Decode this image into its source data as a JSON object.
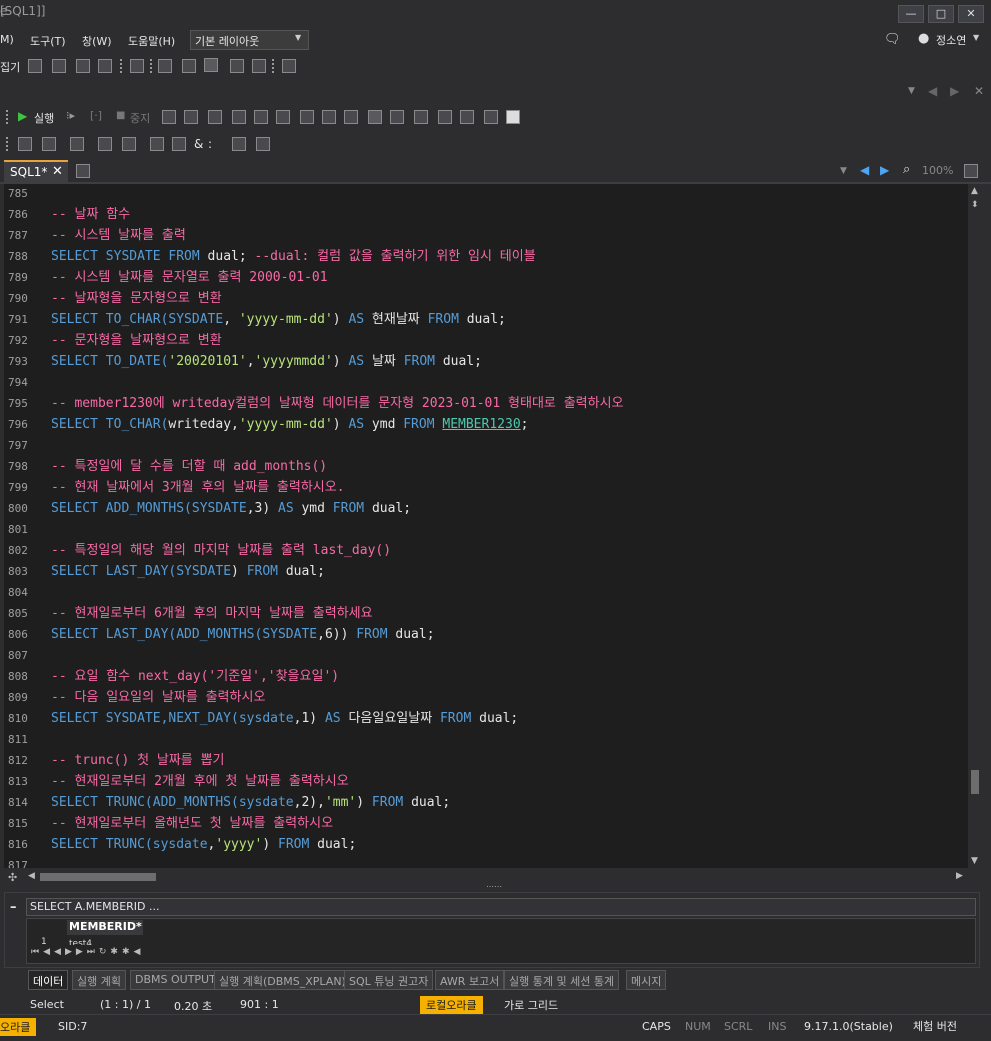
{
  "window": {
    "title": "[SQL1]]",
    "min": "—",
    "max": "□",
    "close": "✕"
  },
  "menu": {
    "items": [
      "M)",
      "도구(T)",
      "창(W)",
      "도움말(H)"
    ],
    "layout_select": "기본 레이아웃",
    "user": "정소연"
  },
  "toolbar": {
    "left_label": "집기",
    "run": "실행",
    "stop": "중지",
    "zoom": "100%"
  },
  "tabs": {
    "active": "SQL1*",
    "close": "✕"
  },
  "editor": {
    "lines": [
      {
        "n": "785",
        "t": []
      },
      {
        "n": "786",
        "t": [
          [
            "c",
            "-- 날짜 함수"
          ]
        ]
      },
      {
        "n": "787",
        "t": [
          [
            "c",
            "-- 시스템 날짜를 출력"
          ]
        ]
      },
      {
        "n": "788",
        "t": [
          [
            "k",
            "SELECT SYSDATE FROM "
          ],
          [
            "p",
            "dual; "
          ],
          [
            "c",
            "--dual: 컬럼 값을 출력하기 위한 임시 테이블"
          ]
        ]
      },
      {
        "n": "789",
        "t": [
          [
            "c",
            "-- 시스템 날짜를 문자열로 출력 2000-01-01"
          ]
        ]
      },
      {
        "n": "790",
        "t": [
          [
            "c",
            "-- 날짜형을 문자형으로 변환"
          ]
        ]
      },
      {
        "n": "791",
        "t": [
          [
            "k",
            "SELECT TO_CHAR("
          ],
          [
            "k",
            "SYSDATE"
          ],
          [
            "p",
            ", "
          ],
          [
            "s",
            "'yyyy-mm-dd'"
          ],
          [
            "p",
            ") "
          ],
          [
            "k",
            "AS "
          ],
          [
            "p",
            "현재날짜 "
          ],
          [
            "k",
            "FROM "
          ],
          [
            "p",
            "dual;"
          ]
        ]
      },
      {
        "n": "792",
        "t": [
          [
            "c",
            "-- 문자형을 날짜형으로 변환"
          ]
        ]
      },
      {
        "n": "793",
        "t": [
          [
            "k",
            "SELECT TO_DATE("
          ],
          [
            "s",
            "'20020101'"
          ],
          [
            "p",
            ","
          ],
          [
            "s",
            "'yyyymmdd'"
          ],
          [
            "p",
            ") "
          ],
          [
            "k",
            "AS "
          ],
          [
            "p",
            "날짜 "
          ],
          [
            "k",
            "FROM "
          ],
          [
            "p",
            "dual;"
          ]
        ]
      },
      {
        "n": "794",
        "t": []
      },
      {
        "n": "795",
        "t": [
          [
            "c",
            "-- member1230에 writeday컬럼의 날짜형 데이터를 문자형 2023-01-01 형태대로 출력하시오"
          ]
        ]
      },
      {
        "n": "796",
        "t": [
          [
            "k",
            "SELECT TO_CHAR("
          ],
          [
            "p",
            "writeday,"
          ],
          [
            "s",
            "'yyyy-mm-dd'"
          ],
          [
            "p",
            ") "
          ],
          [
            "k",
            "AS "
          ],
          [
            "p",
            "ymd "
          ],
          [
            "k",
            "FROM "
          ],
          [
            "u",
            "MEMBER1230"
          ],
          [
            "p",
            ";"
          ]
        ]
      },
      {
        "n": "797",
        "t": []
      },
      {
        "n": "798",
        "t": [
          [
            "c",
            "-- 특정일에 달 수를 더할 때 add_months()"
          ]
        ]
      },
      {
        "n": "799",
        "t": [
          [
            "c",
            "-- 현재 날짜에서 3개월 후의 날짜를 출력하시오."
          ]
        ]
      },
      {
        "n": "800",
        "t": [
          [
            "k",
            "SELECT ADD_MONTHS("
          ],
          [
            "k",
            "SYSDATE"
          ],
          [
            "p",
            ",3) "
          ],
          [
            "k",
            "AS "
          ],
          [
            "p",
            "ymd "
          ],
          [
            "k",
            "FROM "
          ],
          [
            "p",
            "dual;"
          ]
        ]
      },
      {
        "n": "801",
        "t": []
      },
      {
        "n": "802",
        "t": [
          [
            "c",
            "-- 특정일의 해당 월의 마지막 날짜를 출력 last_day()"
          ]
        ]
      },
      {
        "n": "803",
        "t": [
          [
            "k",
            "SELECT LAST_DAY("
          ],
          [
            "k",
            "SYSDATE"
          ],
          [
            "p",
            ") "
          ],
          [
            "k",
            "FROM "
          ],
          [
            "p",
            "dual;"
          ]
        ]
      },
      {
        "n": "804",
        "t": []
      },
      {
        "n": "805",
        "t": [
          [
            "c",
            "-- 현재일로부터 6개월 후의 마지막 날짜를 출력하세요"
          ]
        ]
      },
      {
        "n": "806",
        "t": [
          [
            "k",
            "SELECT LAST_DAY(ADD_MONTHS("
          ],
          [
            "k",
            "SYSDATE"
          ],
          [
            "p",
            ",6)) "
          ],
          [
            "k",
            "FROM "
          ],
          [
            "p",
            "dual;"
          ]
        ]
      },
      {
        "n": "807",
        "t": []
      },
      {
        "n": "808",
        "t": [
          [
            "c",
            "-- 요일 함수 next_day('기준일','찾을요일')"
          ]
        ]
      },
      {
        "n": "809",
        "t": [
          [
            "c",
            "-- 다음 일요일의 날짜를 출력하시오"
          ]
        ]
      },
      {
        "n": "810",
        "t": [
          [
            "k",
            "SELECT SYSDATE,NEXT_DAY("
          ],
          [
            "k",
            "sysdate"
          ],
          [
            "p",
            ",1) "
          ],
          [
            "k",
            "AS "
          ],
          [
            "p",
            "다음일요일날짜 "
          ],
          [
            "k",
            "FROM "
          ],
          [
            "p",
            "dual;"
          ]
        ]
      },
      {
        "n": "811",
        "t": []
      },
      {
        "n": "812",
        "t": [
          [
            "c",
            "-- trunc() 첫 날짜를 뽑기"
          ]
        ]
      },
      {
        "n": "813",
        "t": [
          [
            "c",
            "-- 현재일로부터 2개월 후에 첫 날짜를 출력하시오"
          ]
        ]
      },
      {
        "n": "814",
        "t": [
          [
            "k",
            "SELECT TRUNC(ADD_MONTHS("
          ],
          [
            "k",
            "sysdate"
          ],
          [
            "p",
            ",2),"
          ],
          [
            "s",
            "'mm'"
          ],
          [
            "p",
            ") "
          ],
          [
            "k",
            "FROM "
          ],
          [
            "p",
            "dual;"
          ]
        ]
      },
      {
        "n": "815",
        "t": [
          [
            "c",
            "-- 현재일로부터 올해년도 첫 날짜를 출력하시오"
          ]
        ]
      },
      {
        "n": "816",
        "t": [
          [
            "k",
            "SELECT TRUNC("
          ],
          [
            "k",
            "sysdate"
          ],
          [
            "p",
            ","
          ],
          [
            "s",
            "'yyyy'"
          ],
          [
            "p",
            ") "
          ],
          [
            "k",
            "FROM "
          ],
          [
            "p",
            "dual;"
          ]
        ]
      },
      {
        "n": "817",
        "t": []
      }
    ]
  },
  "results": {
    "query": "SELECT A.MEMBERID ...",
    "column": "MEMBERID*",
    "row_num": "1",
    "row_val": "test4"
  },
  "bottom_tabs": [
    "데이터",
    "실행 계획",
    "DBMS OUTPUT",
    "실행 계획(DBMS_XPLAN)",
    "SQL 튜닝 권고자",
    "AWR 보고서",
    "실행 통계 및 세션 통계",
    "메시지"
  ],
  "status": {
    "mode": "Select",
    "pos": "(1 : 1) / 1",
    "time": "0.20 초",
    "ratio": "901 : 1",
    "badge": "로컬오라클",
    "grid": "가로 그리드",
    "left_badge": "오라클",
    "sid": "SID:7",
    "caps": "CAPS",
    "num": "NUM",
    "scrl": "SCRL",
    "ins": "INS",
    "version": "9.17.1.0(Stable)",
    "edition": "체험 버전"
  }
}
